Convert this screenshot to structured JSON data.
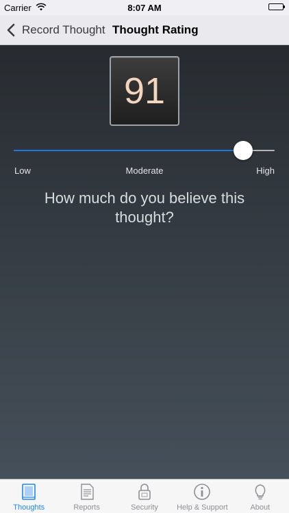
{
  "status_bar": {
    "carrier": "Carrier",
    "time": "8:07 AM"
  },
  "nav": {
    "back_label": "Record Thought",
    "title": "Thought Rating"
  },
  "rating": {
    "value": "91",
    "slider_fraction": 0.88
  },
  "slider_labels": {
    "low": "Low",
    "moderate": "Moderate",
    "high": "High"
  },
  "question": "How much do you believe this thought?",
  "tabs": [
    {
      "label": "Thoughts",
      "icon": "book-icon",
      "active": true
    },
    {
      "label": "Reports",
      "icon": "document-icon",
      "active": false
    },
    {
      "label": "Security",
      "icon": "lock-icon",
      "active": false
    },
    {
      "label": "Help & Support",
      "icon": "info-icon",
      "active": false
    },
    {
      "label": "About",
      "icon": "lightbulb-icon",
      "active": false
    }
  ],
  "colors": {
    "accent": "#1f7ae0",
    "rating_text": "#f3d6bd",
    "tab_active": "#1f86f0",
    "tab_inactive": "#8e8e93"
  }
}
